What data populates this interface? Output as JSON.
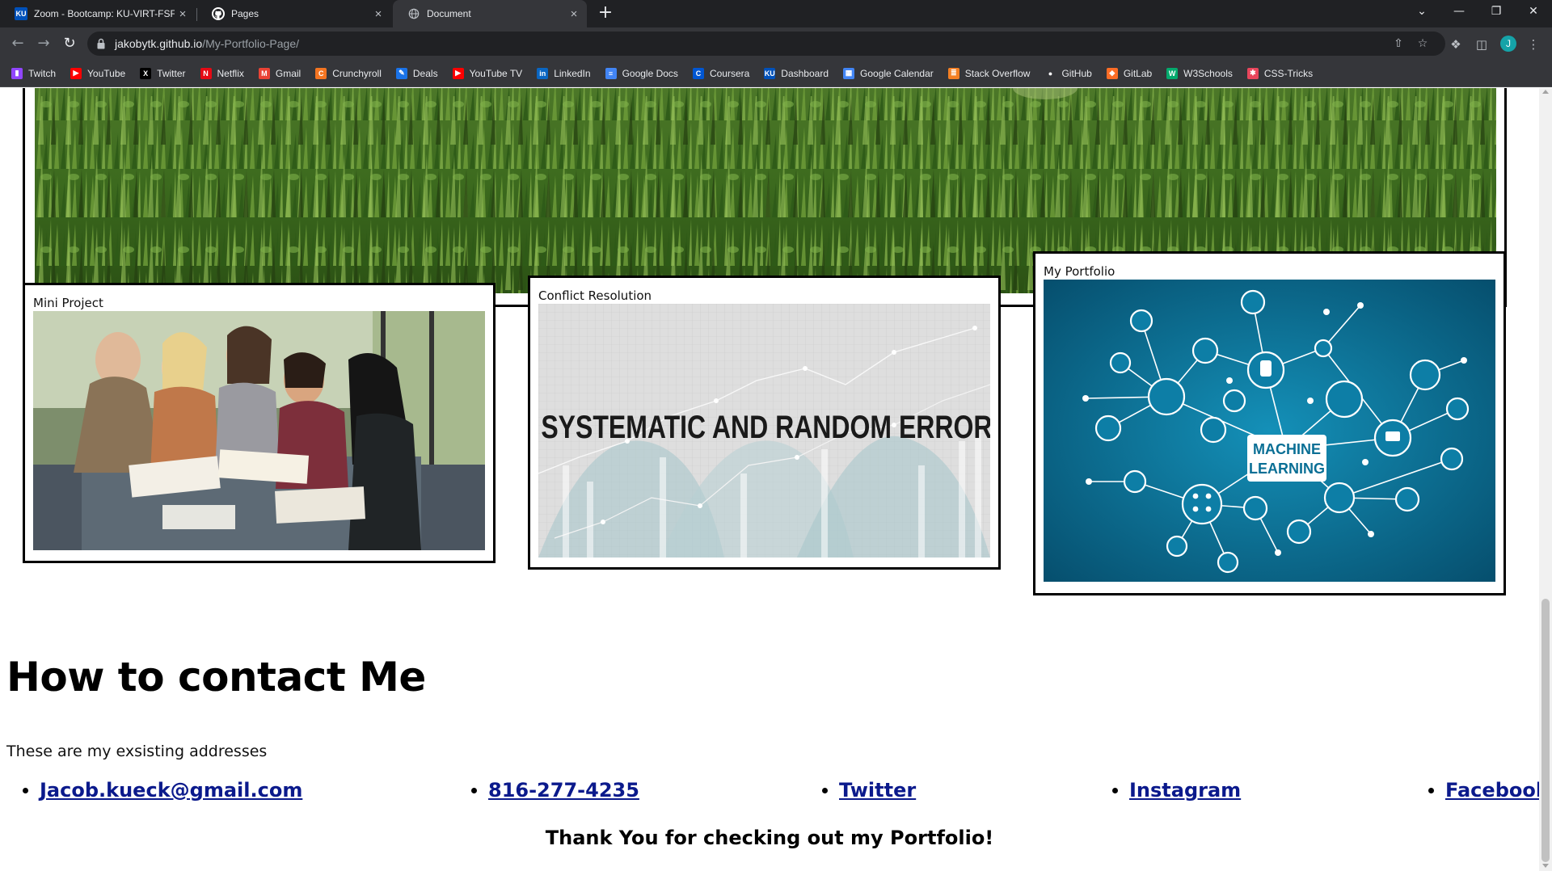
{
  "browser": {
    "tabs": [
      {
        "title": "Zoom - Bootcamp: KU-VIRT-FSF",
        "favicon": "ku-icon",
        "close": "×"
      },
      {
        "title": "Pages",
        "favicon": "github-icon",
        "close": "×"
      },
      {
        "title": "Document",
        "favicon": "globe-icon",
        "close": "×"
      }
    ],
    "new_tab": "+",
    "window_controls": {
      "tab_search": "⌄",
      "minimize": "—",
      "restore": "❐",
      "close": "✕"
    },
    "url_host": "jakobytk.github.io",
    "url_path": "/My-Portfolio-Page/",
    "profile_initial": "J",
    "bookmarks": [
      {
        "label": "Twitch",
        "icon": "twitch-icon",
        "color": "#9146ff"
      },
      {
        "label": "YouTube",
        "icon": "youtube-icon",
        "color": "#ff0000"
      },
      {
        "label": "Twitter",
        "icon": "x-icon",
        "color": "#000000"
      },
      {
        "label": "Netflix",
        "icon": "netflix-icon",
        "color": "#e50914"
      },
      {
        "label": "Gmail",
        "icon": "gmail-icon",
        "color": "#ea4335"
      },
      {
        "label": "Crunchyroll",
        "icon": "crunchyroll-icon",
        "color": "#f47521"
      },
      {
        "label": "Deals",
        "icon": "deals-icon",
        "color": "#1a73e8"
      },
      {
        "label": "YouTube TV",
        "icon": "youtube-tv-icon",
        "color": "#ff0000"
      },
      {
        "label": "LinkedIn",
        "icon": "linkedin-icon",
        "color": "#0a66c2"
      },
      {
        "label": "Google Docs",
        "icon": "google-docs-icon",
        "color": "#4285f4"
      },
      {
        "label": "Coursera",
        "icon": "coursera-icon",
        "color": "#0056d2"
      },
      {
        "label": "Dashboard",
        "icon": "ku-icon",
        "color": "#0051ba"
      },
      {
        "label": "Google Calendar",
        "icon": "google-calendar-icon",
        "color": "#4285f4"
      },
      {
        "label": "Stack Overflow",
        "icon": "stackoverflow-icon",
        "color": "#f48024"
      },
      {
        "label": "GitHub",
        "icon": "github-icon",
        "color": "#ffffff"
      },
      {
        "label": "GitLab",
        "icon": "gitlab-icon",
        "color": "#fc6d26"
      },
      {
        "label": "W3Schools",
        "icon": "w3schools-icon",
        "color": "#04aa6d"
      },
      {
        "label": "CSS-Tricks",
        "icon": "css-tricks-icon",
        "color": "#e8465c"
      }
    ]
  },
  "page": {
    "projects": [
      {
        "caption": "Mini Project",
        "image": "students-studying-photo"
      },
      {
        "caption": "Conflict Resolution",
        "image": "systematic-random-error-graphic",
        "image_text": "SYSTEMATIC AND RANDOM ERROR"
      },
      {
        "caption": "My Portfolio",
        "image": "machine-learning-network-graphic",
        "image_text_1": "MACHINE",
        "image_text_2": "LEARNING"
      }
    ],
    "contact": {
      "heading": "How to contact Me",
      "intro": "These are my exsisting addresses",
      "items": [
        {
          "label": "Jacob.kueck@gmail.com"
        },
        {
          "label": "816-277-4235"
        },
        {
          "label": "Twitter"
        },
        {
          "label": "Instagram"
        },
        {
          "label": "Facebook"
        }
      ],
      "thanks": "Thank You for checking out my Portfolio!"
    }
  },
  "colors": {
    "chrome_dark": "#202124",
    "chrome_toolbar": "#35363a",
    "link": "#0b1a8c",
    "ml_blue": "#0a6f95"
  }
}
